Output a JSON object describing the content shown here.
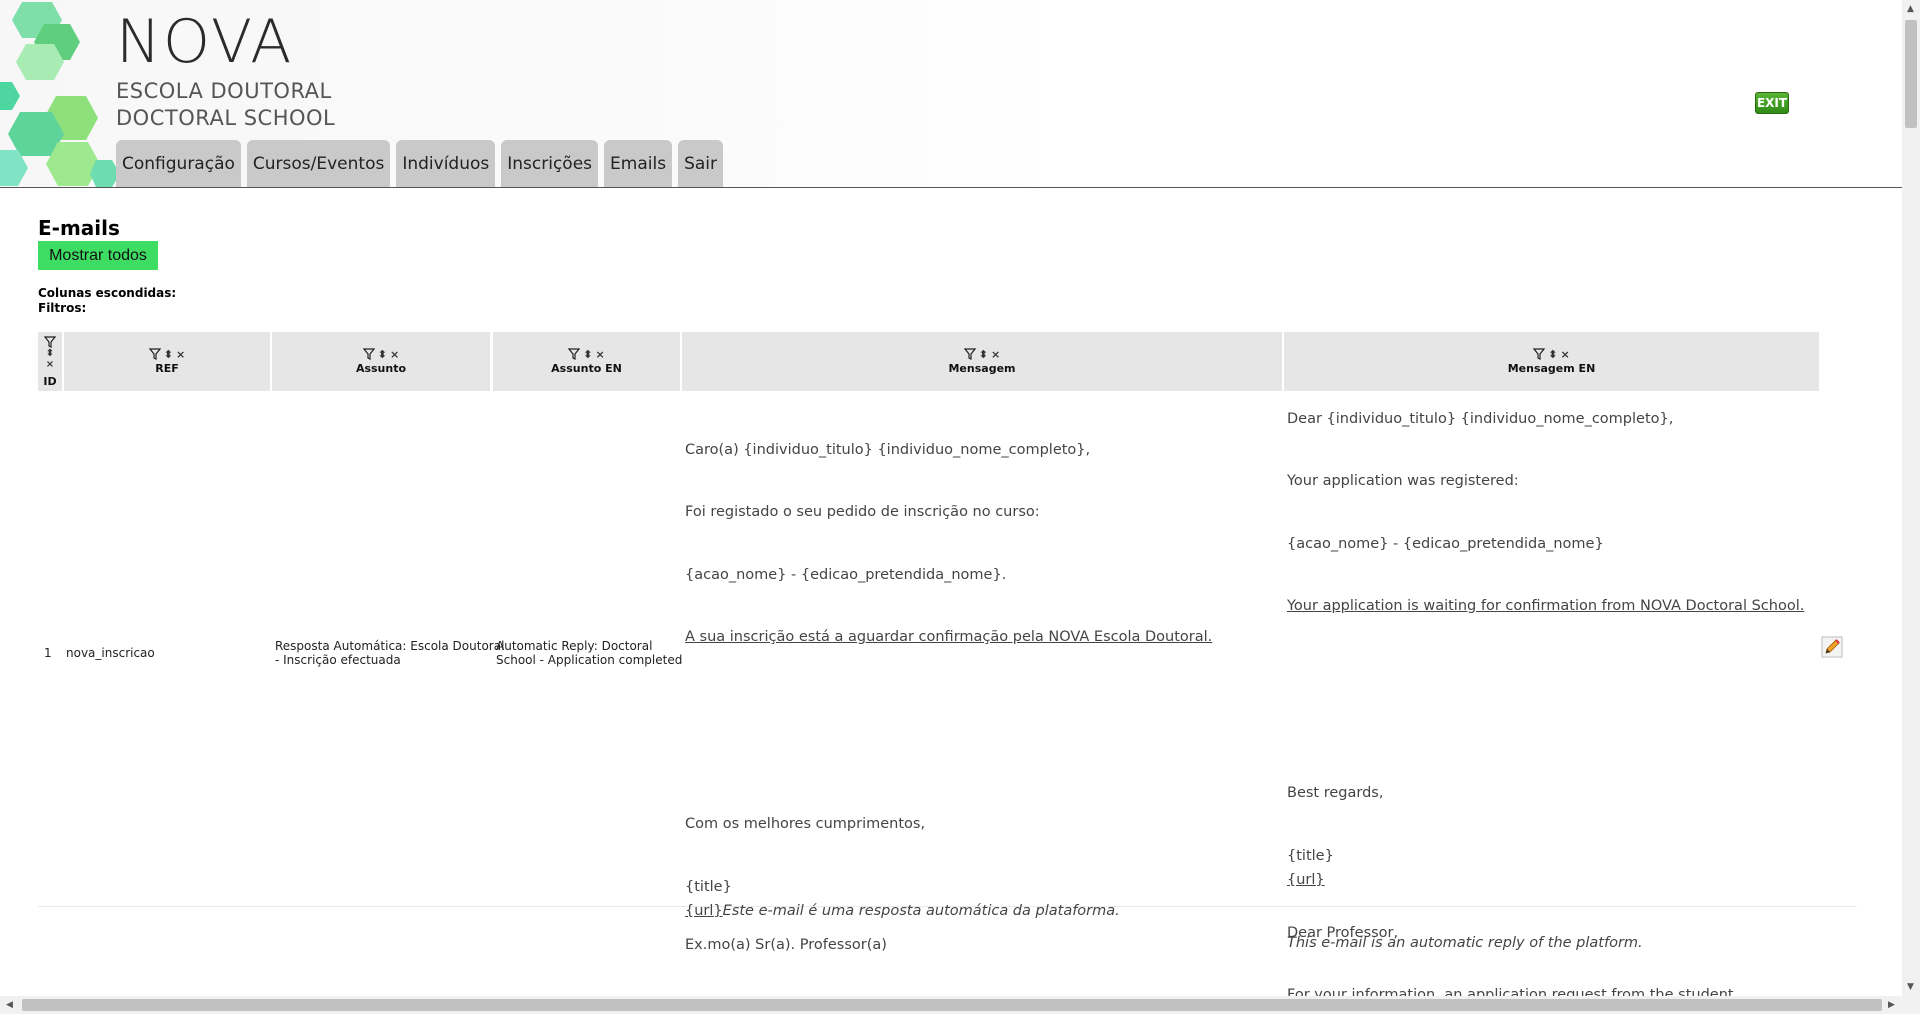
{
  "brand": {
    "name": "NOVA",
    "subtitle_line1": "ESCOLA DOUTORAL",
    "subtitle_line2": "DOCTORAL SCHOOL"
  },
  "exit_label": "EXIT",
  "nav": {
    "items": [
      "Configuração",
      "Cursos/Eventos",
      "Indivíduos",
      "Inscrições",
      "Emails",
      "Sair"
    ]
  },
  "page": {
    "title": "E-mails",
    "show_all_label": "Mostrar todos",
    "hidden_columns_label": "Colunas escondidas:",
    "filters_label": "Filtros:"
  },
  "table": {
    "columns": [
      "ID",
      "REF",
      "Assunto",
      "Assunto EN",
      "Mensagem",
      "Mensagem EN"
    ],
    "controls": {
      "filter": "filter-icon",
      "sort": "⬍",
      "remove": "×"
    },
    "rows": [
      {
        "id": "1",
        "ref": "nova_inscricao",
        "assunto": [
          "Resposta Automática: Escola Doutoral",
          "- Inscrição efectuada"
        ],
        "assunto_en": [
          "Automatic Reply: Doctoral",
          "School - Application completed"
        ],
        "mensagem": {
          "greeting": "Caro(a) {individuo_titulo} {individuo_nome_completo},",
          "line1": "Foi registado o seu pedido de inscrição no curso:",
          "line2": "{acao_nome} - {edicao_pretendida_nome}.",
          "line3": "A sua inscrição está a aguardar confirmação pela NOVA Escola Doutoral.",
          "closing": "Com os melhores cumprimentos,",
          "title": "{title}",
          "url": "{url}",
          "auto": "Este e-mail é uma resposta automática da plataforma."
        },
        "mensagem_en": {
          "greeting": "Dear {individuo_titulo} {individuo_nome_completo},",
          "line1": "Your application was registered:",
          "line2": "{acao_nome} - {edicao_pretendida_nome}",
          "line3": "Your application is waiting for confirmation from NOVA Doctoral School.",
          "closing": "Best regards,",
          "title": "{title}",
          "url": "{url}",
          "auto": "This e-mail is an automatic reply of the platform."
        }
      },
      {
        "mensagem": {
          "greeting": "Ex.mo(a) Sr(a). Professor(a)"
        },
        "mensagem_en": {
          "greeting": "Dear Professor,",
          "line1": "For your information, an application request from the student"
        }
      }
    ]
  },
  "colors": {
    "tab_bg": "#c9c9c9",
    "header_cell_bg": "#e6e6e6",
    "show_all_bg": "#3ddc62",
    "exit_bg": "#3f9e22"
  },
  "icons": {
    "edit": "pencil-icon",
    "exit": "exit-icon",
    "filter": "filter-icon",
    "sort": "sort-icon",
    "remove": "remove-icon"
  }
}
